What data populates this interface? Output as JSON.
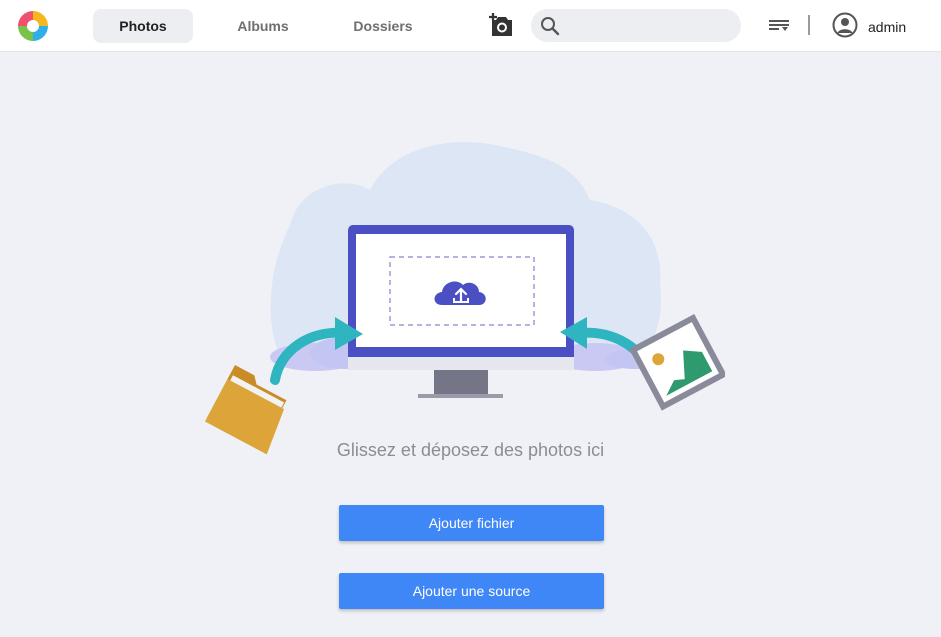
{
  "header": {
    "logo_icon": "app-logo",
    "tabs": [
      {
        "label": "Photos",
        "active": true
      },
      {
        "label": "Albums",
        "active": false
      },
      {
        "label": "Dossiers",
        "active": false
      }
    ],
    "camera_icon": "add-camera-icon",
    "search": {
      "value": "",
      "placeholder": "",
      "icon": "search-icon"
    },
    "sort_icon": "sort-icon",
    "user": {
      "icon": "user-avatar-icon",
      "name": "admin"
    }
  },
  "main": {
    "drop_message": "Glissez et déposez des photos ici",
    "buttons": {
      "add_file": "Ajouter fichier",
      "add_source": "Ajouter une source"
    }
  },
  "colors": {
    "accent": "#3f86f7",
    "monitor": "#4b4fc4",
    "arrow": "#2fb5bf",
    "folder": "#dda43a",
    "photo_mountain": "#2e9a6e"
  }
}
